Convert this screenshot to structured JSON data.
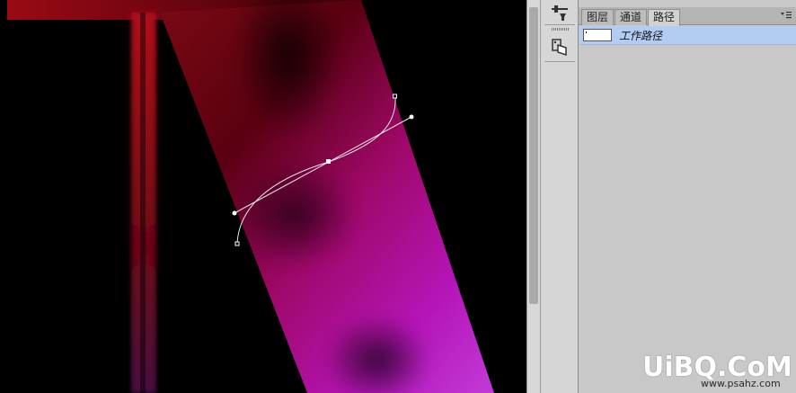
{
  "panel": {
    "tabs": [
      {
        "label": "图层",
        "active": false
      },
      {
        "label": "通道",
        "active": false
      },
      {
        "label": "路径",
        "active": true
      }
    ],
    "menu_icon": "panel-menu-icon",
    "paths": [
      {
        "name": "工作路径",
        "selected": true
      }
    ]
  },
  "toolstrip": {
    "icons": [
      "adjustments-brush-icon",
      "transform-paths-icon"
    ]
  },
  "watermark": {
    "main": "UiBQ.CoM",
    "sub": "www.psahz.com"
  },
  "colors": {
    "selection": "#b3ccf3",
    "panel_bg": "#c8c8c8",
    "canvas_bg": "#000000"
  }
}
